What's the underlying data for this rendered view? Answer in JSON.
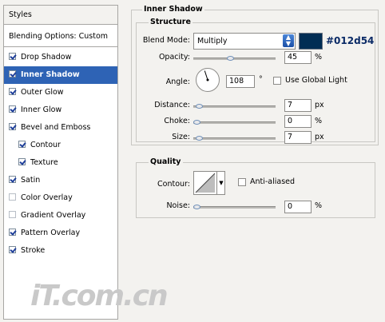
{
  "styles_list": {
    "header": "Styles",
    "blending_options": "Blending Options: Custom",
    "items": [
      {
        "label": "Drop Shadow",
        "checked": true,
        "active": false,
        "indent": false
      },
      {
        "label": "Inner Shadow",
        "checked": true,
        "active": true,
        "indent": false
      },
      {
        "label": "Outer Glow",
        "checked": true,
        "active": false,
        "indent": false
      },
      {
        "label": "Inner Glow",
        "checked": true,
        "active": false,
        "indent": false
      },
      {
        "label": "Bevel and Emboss",
        "checked": true,
        "active": false,
        "indent": false
      },
      {
        "label": "Contour",
        "checked": true,
        "active": false,
        "indent": true
      },
      {
        "label": "Texture",
        "checked": true,
        "active": false,
        "indent": true
      },
      {
        "label": "Satin",
        "checked": true,
        "active": false,
        "indent": false
      },
      {
        "label": "Color Overlay",
        "checked": false,
        "active": false,
        "indent": false
      },
      {
        "label": "Gradient Overlay",
        "checked": false,
        "active": false,
        "indent": false
      },
      {
        "label": "Pattern Overlay",
        "checked": true,
        "active": false,
        "indent": false
      },
      {
        "label": "Stroke",
        "checked": true,
        "active": false,
        "indent": false
      }
    ]
  },
  "inner_shadow": {
    "title": "Inner Shadow",
    "structure": {
      "title": "Structure",
      "blend_mode_label": "Blend Mode:",
      "blend_mode_value": "Multiply",
      "color": "#012d54",
      "color_label": "#012d54",
      "opacity_label": "Opacity:",
      "opacity_value": "45",
      "opacity_unit": "%",
      "opacity_fraction": 0.45,
      "angle_label": "Angle:",
      "angle_value": "108",
      "angle_unit": "°",
      "angle_degrees": 108,
      "use_global_light_label": "Use Global Light",
      "use_global_light_checked": false,
      "distance_label": "Distance:",
      "distance_value": "7",
      "distance_unit": "px",
      "distance_fraction": 0.03,
      "choke_label": "Choke:",
      "choke_value": "0",
      "choke_unit": "%",
      "choke_fraction": 0.0,
      "size_label": "Size:",
      "size_value": "7",
      "size_unit": "px",
      "size_fraction": 0.03
    },
    "quality": {
      "title": "Quality",
      "contour_label": "Contour:",
      "anti_aliased_label": "Anti-aliased",
      "anti_aliased_checked": false,
      "noise_label": "Noise:",
      "noise_value": "0",
      "noise_unit": "%",
      "noise_fraction": 0.0
    }
  },
  "watermark": "iT.com.cn",
  "colors": {
    "active_item": "#2e63b5",
    "panel_bg": "#f3f2ef"
  }
}
